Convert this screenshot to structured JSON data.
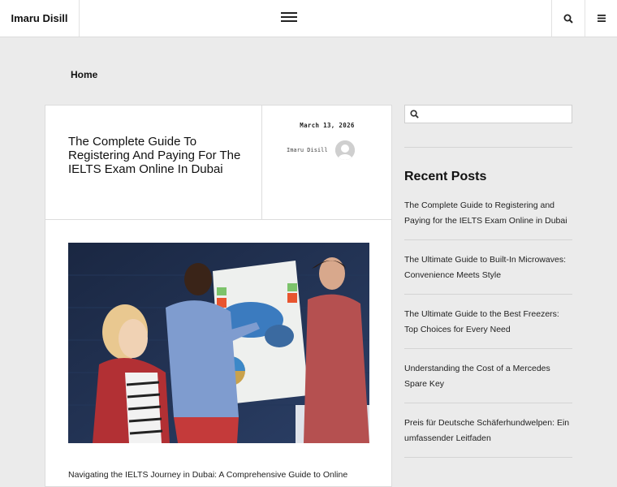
{
  "header": {
    "site_title": "Imaru Disill",
    "menu_icon": "hamburger-icon",
    "search_icon": "search-icon",
    "side_menu_icon": "list-icon"
  },
  "breadcrumb": {
    "home": "Home"
  },
  "article": {
    "title": "The Complete Guide To Registering And Paying For The IELTS Exam Online In Dubai",
    "date": "March 13, 2026",
    "author": "Imaru Disill",
    "excerpt": "Navigating the IELTS Journey in Dubai: A Comprehensive Guide to Online"
  },
  "sidebar": {
    "search_placeholder": "",
    "recent_title": "Recent Posts",
    "recent_posts": [
      {
        "title": "The Complete Guide to Registering and Paying for the IELTS Exam Online in Dubai"
      },
      {
        "title": "The Ultimate Guide to Built-In Microwaves: Convenience Meets Style"
      },
      {
        "title": "The Ultimate Guide to the Best Freezers: Top Choices for Every Need"
      },
      {
        "title": "Understanding the Cost of a Mercedes Spare Key"
      },
      {
        "title": "Preis für Deutsche Schäferhundwelpen: Ein umfassender Leitfaden"
      }
    ]
  },
  "colors": {
    "background": "#ebebeb",
    "card": "#ffffff",
    "text": "#222222"
  }
}
